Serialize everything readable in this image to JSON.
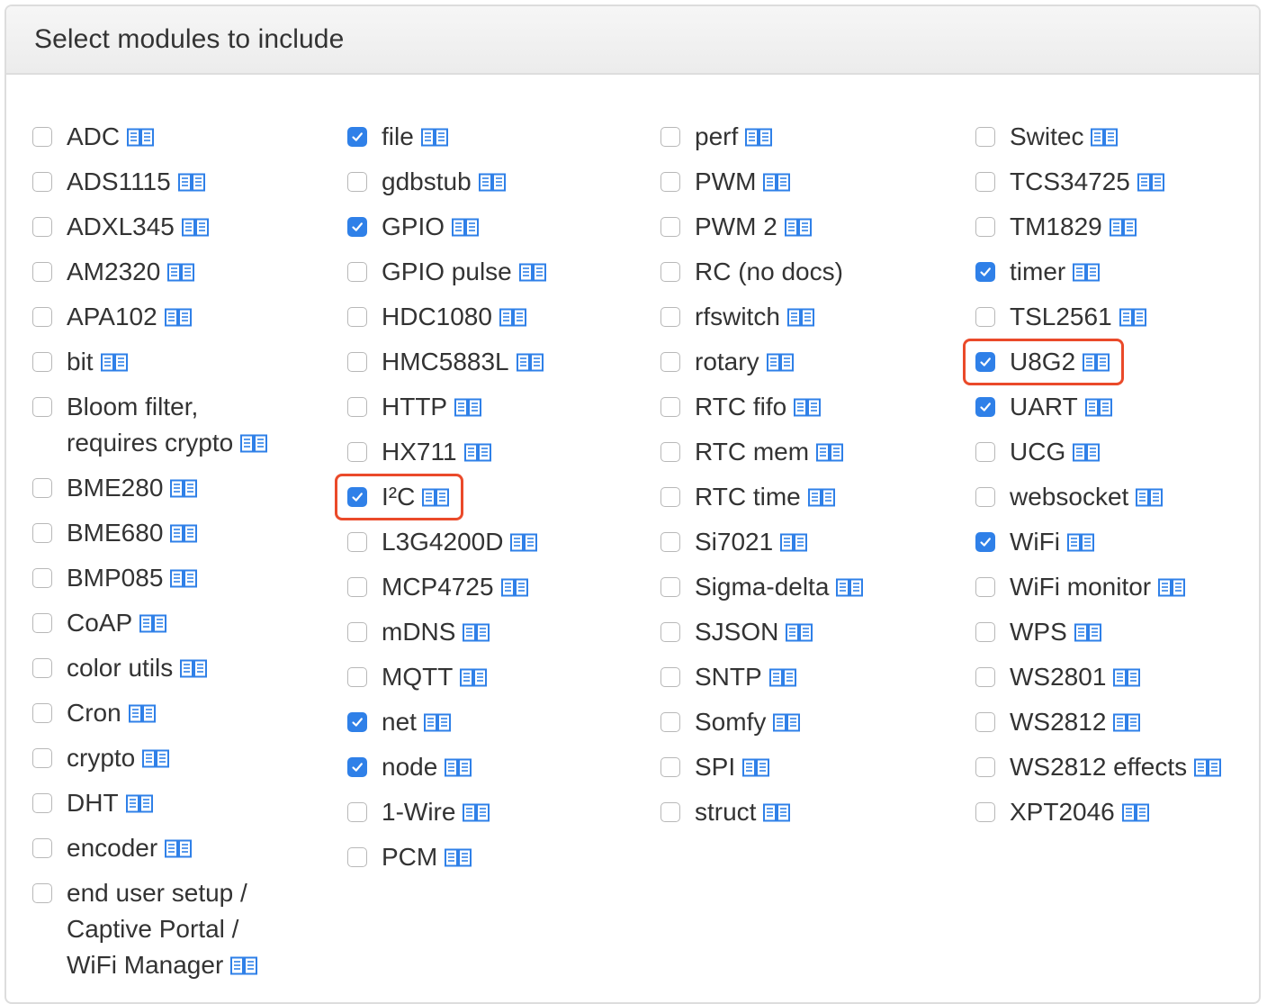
{
  "title": "Select modules to include",
  "colors": {
    "accent": "#2f80e8",
    "highlight": "#ea4a2a",
    "doc_icon": "#2f80e8"
  },
  "doc_icon": "book-icon",
  "columns": [
    [
      {
        "label": "ADC",
        "checked": false
      },
      {
        "label": "ADS1115",
        "checked": false
      },
      {
        "label": "ADXL345",
        "checked": false
      },
      {
        "label": "AM2320",
        "checked": false
      },
      {
        "label": "APA102",
        "checked": false
      },
      {
        "label": "bit",
        "checked": false
      },
      {
        "label": "Bloom filter, requires crypto",
        "checked": false
      },
      {
        "label": "BME280",
        "checked": false
      },
      {
        "label": "BME680",
        "checked": false
      },
      {
        "label": "BMP085",
        "checked": false
      },
      {
        "label": "CoAP",
        "checked": false
      },
      {
        "label": "color utils",
        "checked": false
      },
      {
        "label": "Cron",
        "checked": false
      },
      {
        "label": "crypto",
        "checked": false
      },
      {
        "label": "DHT",
        "checked": false
      },
      {
        "label": "encoder",
        "checked": false
      },
      {
        "label": "end user setup / Captive Portal / WiFi Manager",
        "checked": false
      }
    ],
    [
      {
        "label": "file",
        "checked": true
      },
      {
        "label": "gdbstub",
        "checked": false
      },
      {
        "label": "GPIO",
        "checked": true
      },
      {
        "label": "GPIO pulse",
        "checked": false
      },
      {
        "label": "HDC1080",
        "checked": false
      },
      {
        "label": "HMC5883L",
        "checked": false
      },
      {
        "label": "HTTP",
        "checked": false
      },
      {
        "label": "HX711",
        "checked": false
      },
      {
        "label": "I²C",
        "checked": true,
        "highlighted": true
      },
      {
        "label": "L3G4200D",
        "checked": false
      },
      {
        "label": "MCP4725",
        "checked": false
      },
      {
        "label": "mDNS",
        "checked": false
      },
      {
        "label": "MQTT",
        "checked": false
      },
      {
        "label": "net",
        "checked": true
      },
      {
        "label": "node",
        "checked": true
      },
      {
        "label": "1-Wire",
        "checked": false
      },
      {
        "label": "PCM",
        "checked": false
      }
    ],
    [
      {
        "label": "perf",
        "checked": false
      },
      {
        "label": "PWM",
        "checked": false
      },
      {
        "label": "PWM 2",
        "checked": false
      },
      {
        "label": "RC (no docs)",
        "checked": false,
        "no_doc": true
      },
      {
        "label": "rfswitch",
        "checked": false
      },
      {
        "label": "rotary",
        "checked": false
      },
      {
        "label": "RTC fifo",
        "checked": false
      },
      {
        "label": "RTC mem",
        "checked": false
      },
      {
        "label": "RTC time",
        "checked": false
      },
      {
        "label": "Si7021",
        "checked": false
      },
      {
        "label": "Sigma-delta",
        "checked": false
      },
      {
        "label": "SJSON",
        "checked": false
      },
      {
        "label": "SNTP",
        "checked": false
      },
      {
        "label": "Somfy",
        "checked": false
      },
      {
        "label": "SPI",
        "checked": false
      },
      {
        "label": "struct",
        "checked": false
      }
    ],
    [
      {
        "label": "Switec",
        "checked": false
      },
      {
        "label": "TCS34725",
        "checked": false
      },
      {
        "label": "TM1829",
        "checked": false
      },
      {
        "label": "timer",
        "checked": true
      },
      {
        "label": "TSL2561",
        "checked": false
      },
      {
        "label": "U8G2",
        "checked": true,
        "highlighted": true
      },
      {
        "label": "UART",
        "checked": true
      },
      {
        "label": "UCG",
        "checked": false
      },
      {
        "label": "websocket",
        "checked": false
      },
      {
        "label": "WiFi",
        "checked": true
      },
      {
        "label": "WiFi monitor",
        "checked": false
      },
      {
        "label": "WPS",
        "checked": false
      },
      {
        "label": "WS2801",
        "checked": false
      },
      {
        "label": "WS2812",
        "checked": false
      },
      {
        "label": "WS2812 effects",
        "checked": false
      },
      {
        "label": "XPT2046",
        "checked": false
      }
    ]
  ]
}
